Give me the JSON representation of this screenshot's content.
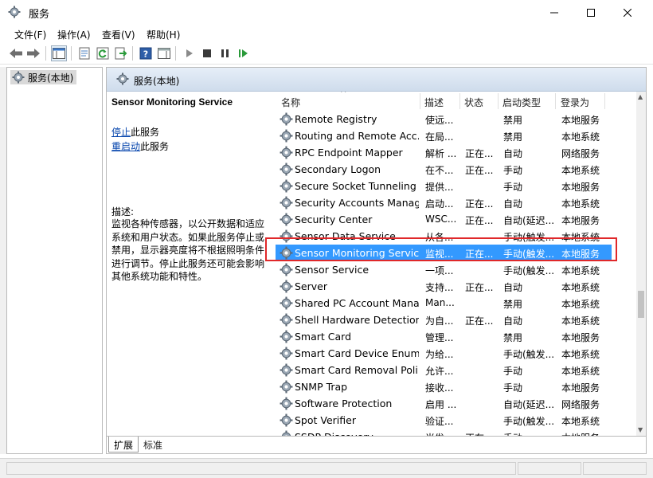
{
  "window": {
    "title": "服务",
    "controls": {
      "minimize": "minimize",
      "maximize": "maximize",
      "close": "close"
    }
  },
  "menu": [
    {
      "label": "文件(F)"
    },
    {
      "label": "操作(A)"
    },
    {
      "label": "查看(V)"
    },
    {
      "label": "帮助(H)"
    }
  ],
  "toolbar": {
    "icons": [
      "back-arrow-icon",
      "forward-arrow-icon",
      "console-tree-icon",
      "properties-icon",
      "refresh-icon",
      "export-list-icon",
      "help-icon",
      "show-pane-icon",
      "start-icon",
      "stop-icon",
      "pause-icon",
      "restart-icon"
    ]
  },
  "tree": {
    "node_label": "服务(本地)"
  },
  "pane": {
    "header_title": "服务(本地)"
  },
  "description": {
    "service_name": "Sensor Monitoring Service",
    "stop_link": "停止",
    "stop_suffix": "此服务",
    "restart_link": "重启动",
    "restart_suffix": "此服务",
    "label": "描述:",
    "text": "监视各种传感器，以公开数据和适应系统和用户状态。如果此服务停止或禁用，显示器亮度将不根据照明条件进行调节。停止此服务还可能会影响其他系统功能和特性。"
  },
  "columns": {
    "name": "名称",
    "desc": "描述",
    "status": "状态",
    "startup": "启动类型",
    "logon": "登录为"
  },
  "rows": [
    {
      "name": "Remote Registry",
      "desc": "使远...",
      "status": "",
      "startup": "禁用",
      "logon": "本地服务"
    },
    {
      "name": "Routing and Remote Acc...",
      "desc": "在局...",
      "status": "",
      "startup": "禁用",
      "logon": "本地系统"
    },
    {
      "name": "RPC Endpoint Mapper",
      "desc": "解析 ...",
      "status": "正在...",
      "startup": "自动",
      "logon": "网络服务"
    },
    {
      "name": "Secondary Logon",
      "desc": "在不...",
      "status": "正在...",
      "startup": "手动",
      "logon": "本地系统"
    },
    {
      "name": "Secure Socket Tunneling ...",
      "desc": "提供...",
      "status": "",
      "startup": "手动",
      "logon": "本地服务"
    },
    {
      "name": "Security Accounts Manag...",
      "desc": "启动...",
      "status": "正在...",
      "startup": "自动",
      "logon": "本地系统"
    },
    {
      "name": "Security Center",
      "desc": "WSC...",
      "status": "正在...",
      "startup": "自动(延迟...",
      "logon": "本地服务"
    },
    {
      "name": "Sensor Data Service",
      "desc": "从各...",
      "status": "",
      "startup": "手动(触发...",
      "logon": "本地系统"
    },
    {
      "name": "Sensor Monitoring Service",
      "desc": "监视...",
      "status": "正在...",
      "startup": "手动(触发...",
      "logon": "本地服务",
      "selected": true
    },
    {
      "name": "Sensor Service",
      "desc": "一项...",
      "status": "",
      "startup": "手动(触发...",
      "logon": "本地系统"
    },
    {
      "name": "Server",
      "desc": "支持...",
      "status": "正在...",
      "startup": "自动",
      "logon": "本地系统"
    },
    {
      "name": "Shared PC Account Mana...",
      "desc": "Man...",
      "status": "",
      "startup": "禁用",
      "logon": "本地系统"
    },
    {
      "name": "Shell Hardware Detection",
      "desc": "为自...",
      "status": "正在...",
      "startup": "自动",
      "logon": "本地系统"
    },
    {
      "name": "Smart Card",
      "desc": "管理...",
      "status": "",
      "startup": "禁用",
      "logon": "本地服务"
    },
    {
      "name": "Smart Card Device Enum...",
      "desc": "为给...",
      "status": "",
      "startup": "手动(触发...",
      "logon": "本地系统"
    },
    {
      "name": "Smart Card Removal Poli...",
      "desc": "允许...",
      "status": "",
      "startup": "手动",
      "logon": "本地系统"
    },
    {
      "name": "SNMP Trap",
      "desc": "接收...",
      "status": "",
      "startup": "手动",
      "logon": "本地服务"
    },
    {
      "name": "Software Protection",
      "desc": "启用 ...",
      "status": "",
      "startup": "自动(延迟...",
      "logon": "网络服务"
    },
    {
      "name": "Spot Verifier",
      "desc": "验证...",
      "status": "",
      "startup": "手动(触发...",
      "logon": "本地系统"
    },
    {
      "name": "SSDP Discovery",
      "desc": "当发...",
      "status": "正在...",
      "startup": "手动",
      "logon": "本地服务"
    }
  ],
  "tabs": [
    {
      "label": "扩展"
    },
    {
      "label": "标准"
    }
  ],
  "colors": {
    "selection": "#3399ff",
    "highlight_box": "#e0282a",
    "link": "#0645ad"
  }
}
